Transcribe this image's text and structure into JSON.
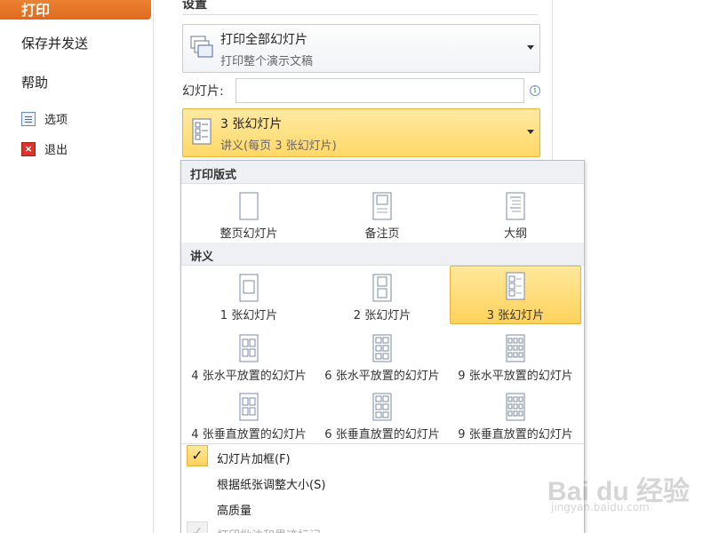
{
  "nav": {
    "print": "打印",
    "save_send": "保存并发送",
    "help": "帮助",
    "options": "选项",
    "exit": "退出"
  },
  "settings": {
    "title": "设置",
    "print_range": {
      "line1": "打印全部幻灯片",
      "line2": "打印整个演示文稿"
    },
    "slides_label": "幻灯片:",
    "slides_value": "",
    "layout": {
      "line1": "3 张幻灯片",
      "line2": "讲义(每页 3 张幻灯片)"
    }
  },
  "panel": {
    "print_layout_header": "打印版式",
    "layouts": [
      "整页幻灯片",
      "备注页",
      "大纲"
    ],
    "handouts_header": "讲义",
    "handouts": [
      "1 张幻灯片",
      "2 张幻灯片",
      "3 张幻灯片",
      "4 张水平放置的幻灯片",
      "6 张水平放置的幻灯片",
      "9 张水平放置的幻灯片",
      "4 张垂直放置的幻灯片",
      "6 张垂直放置的幻灯片",
      "9 张垂直放置的幻灯片"
    ],
    "selected_handout": "3 张幻灯片",
    "options": [
      "幻灯片加框(F)",
      "根据纸张调整大小(S)",
      "高质量",
      "打印批注和墨迹标记"
    ],
    "check_mark": "✓"
  },
  "watermark": {
    "brand": "Bai du 经验",
    "url": "jingyan.baidu.com"
  },
  "colors": {
    "accent": "#e06a1c",
    "selected": "#ffd866"
  }
}
